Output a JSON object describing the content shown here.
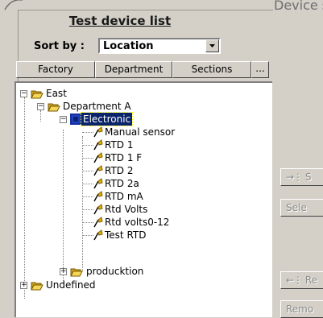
{
  "window": {
    "title": "Device se"
  },
  "list": {
    "title": "Test device list"
  },
  "sort": {
    "label": "Sort by :",
    "value": "Location"
  },
  "tabs": [
    "Factory",
    "Department",
    "Sections",
    "..."
  ],
  "tree": {
    "east": "East",
    "department_a": "Department A",
    "electronic": "Electronic",
    "sensors": [
      "Manual sensor",
      "RTD 1",
      "RTD 1 F",
      "RTD 2",
      "RTD 2a",
      "RTD mA",
      "Rtd Volts",
      "Rtd volts0-12",
      "Test RTD"
    ],
    "producktion": "producktion",
    "undefined": "Undefined"
  },
  "right_buttons": {
    "select_arrow": "S",
    "select_all": "Sele",
    "remove_arrow": "Re",
    "remove_all": "Remo"
  },
  "colors": {
    "selection": "#0a246a",
    "folder": "#e8c440",
    "sensor": "#d4a000"
  }
}
